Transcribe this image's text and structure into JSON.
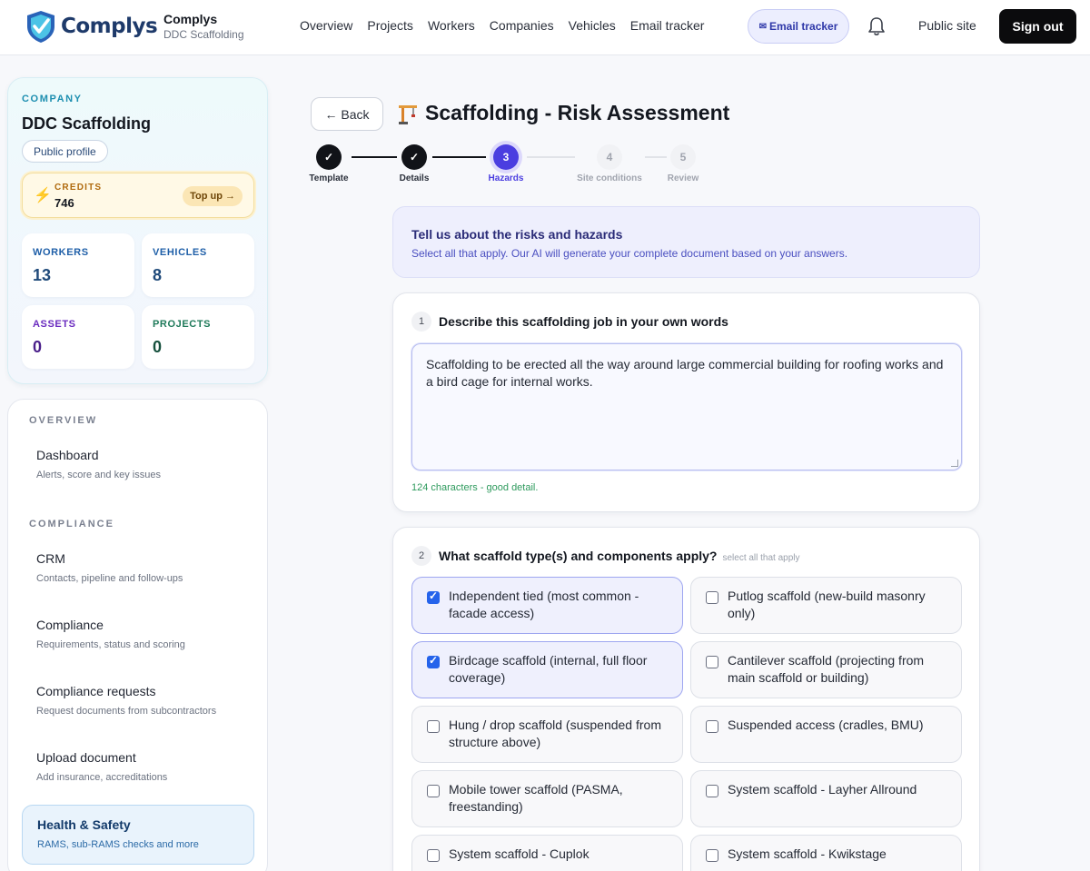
{
  "header": {
    "brand": "Complys",
    "org_name": "Complys",
    "org_sub": "DDC Scaffolding",
    "nav": [
      "Overview",
      "Projects",
      "Workers",
      "Companies",
      "Vehicles",
      "Email tracker"
    ],
    "email_pill": "Email tracker",
    "public_site": "Public site",
    "sign_out": "Sign out"
  },
  "company": {
    "label": "COMPANY",
    "name": "DDC Scaffolding",
    "public_profile": "Public profile",
    "credits_label": "CREDITS",
    "credits_value": "746",
    "top_up": "Top up →",
    "stats": [
      {
        "label": "WORKERS",
        "value": "13",
        "color": "#1f5fa8"
      },
      {
        "label": "VEHICLES",
        "value": "8",
        "color": "#1f5fa8"
      },
      {
        "label": "ASSETS",
        "value": "0",
        "color": "#6a2bbf"
      },
      {
        "label": "PROJECTS",
        "value": "0",
        "color": "#1f7a5a"
      }
    ]
  },
  "sidebar": {
    "overview_label": "OVERVIEW",
    "compliance_label": "COMPLIANCE",
    "items": [
      {
        "title": "Dashboard",
        "desc": "Alerts, score and key issues"
      },
      {
        "title": "CRM",
        "desc": "Contacts, pipeline and follow-ups"
      },
      {
        "title": "Compliance",
        "desc": "Requirements, status and scoring"
      },
      {
        "title": "Compliance requests",
        "desc": "Request documents from subcontractors"
      },
      {
        "title": "Upload document",
        "desc": "Add insurance, accreditations"
      },
      {
        "title": "Health & Safety",
        "desc": "RAMS, sub-RAMS checks and more"
      }
    ]
  },
  "main": {
    "back": "← Back",
    "title": "Scaffolding - Risk Assessment",
    "steps": [
      {
        "num": "✓",
        "label": "Template",
        "state": "done"
      },
      {
        "num": "✓",
        "label": "Details",
        "state": "done"
      },
      {
        "num": "3",
        "label": "Hazards",
        "state": "active"
      },
      {
        "num": "4",
        "label": "Site conditions",
        "state": "todo"
      },
      {
        "num": "5",
        "label": "Review",
        "state": "todo"
      }
    ],
    "intro_title": "Tell us about the risks and hazards",
    "intro_sub": "Select all that apply. Our AI will generate your complete document based on your answers.",
    "q1": {
      "num": "1",
      "title": "Describe this scaffolding job in your own words",
      "value": "Scaffolding to be erected all the way around large commercial building for roofing works and a bird cage for internal works.",
      "char_count": "124 characters - good detail."
    },
    "q2": {
      "num": "2",
      "title": "What scaffold type(s) and components apply?",
      "hint": "select all that apply",
      "options": [
        {
          "label": "Independent tied (most common - facade access)",
          "checked": true
        },
        {
          "label": "Putlog scaffold (new-build masonry only)",
          "checked": false
        },
        {
          "label": "Birdcage scaffold (internal, full floor coverage)",
          "checked": true
        },
        {
          "label": "Cantilever scaffold (projecting from main scaffold or building)",
          "checked": false
        },
        {
          "label": "Hung / drop scaffold (suspended from structure above)",
          "checked": false
        },
        {
          "label": "Suspended access (cradles, BMU)",
          "checked": false
        },
        {
          "label": "Mobile tower scaffold (PASMA, freestanding)",
          "checked": false
        },
        {
          "label": "System scaffold - Layher Allround",
          "checked": false
        },
        {
          "label": "System scaffold - Cuplok",
          "checked": false
        },
        {
          "label": "System scaffold - Kwikstage",
          "checked": false
        }
      ]
    }
  },
  "colors": {
    "accent": "#4b3ee0",
    "check": "#2563eb",
    "done": "#111318"
  }
}
